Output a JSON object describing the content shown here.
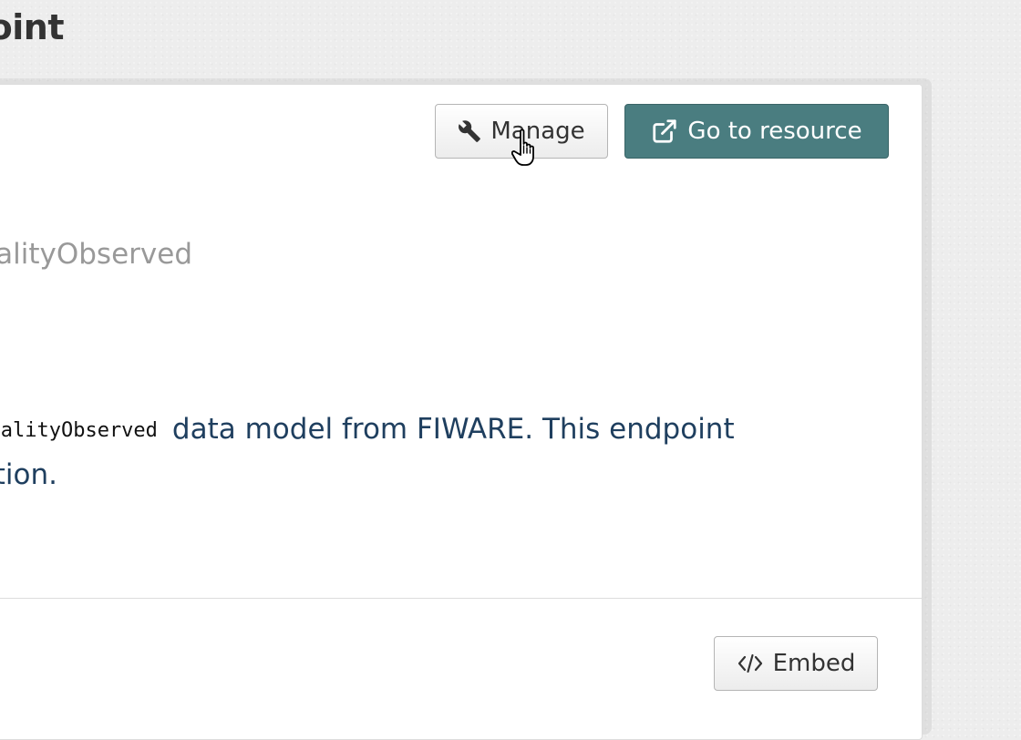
{
  "header": {
    "title_fragment": "oint"
  },
  "toolbar": {
    "manage_label": "Manage",
    "manage_icon": "wrench-icon",
    "go_to_resource_label": "Go to resource",
    "go_to_resource_icon": "external-link-icon"
  },
  "resource": {
    "type_fragment": "ualityObserved",
    "description": {
      "code_fragment": "rQualityObserved",
      "line1_text": "data model from FIWARE. This endpoint",
      "line2_text": "tion."
    }
  },
  "footer": {
    "embed_label": "Embed",
    "embed_icon": "code-icon"
  },
  "colors": {
    "accent": "#4a7d80",
    "description_text": "#1f3f5f",
    "muted_text": "#999999"
  }
}
